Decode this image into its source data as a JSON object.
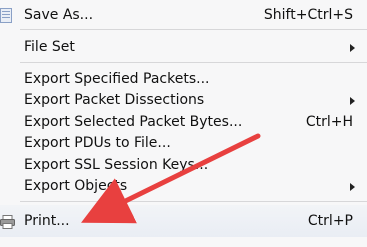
{
  "menu": {
    "items": [
      {
        "label": "Save As...",
        "shortcut": "Shift+Ctrl+S"
      },
      {
        "label": "File Set"
      },
      {
        "label": "Export Specified Packets..."
      },
      {
        "label": "Export Packet Dissections"
      },
      {
        "label": "Export Selected Packet Bytes...",
        "shortcut": "Ctrl+H"
      },
      {
        "label": "Export PDUs to File..."
      },
      {
        "label": "Export SSL Session Keys..."
      },
      {
        "label": "Export Objects"
      },
      {
        "label": "Print...",
        "shortcut": "Ctrl+P"
      }
    ]
  },
  "colors": {
    "arrow": "#e8403f",
    "menu_bg": "#f7f7f8",
    "separator": "#d7d7d9",
    "hover_bg": "#eef1f6"
  },
  "icons": {
    "save": "save-document-icon",
    "print": "printer-icon",
    "submenu": "submenu-arrow-icon"
  }
}
